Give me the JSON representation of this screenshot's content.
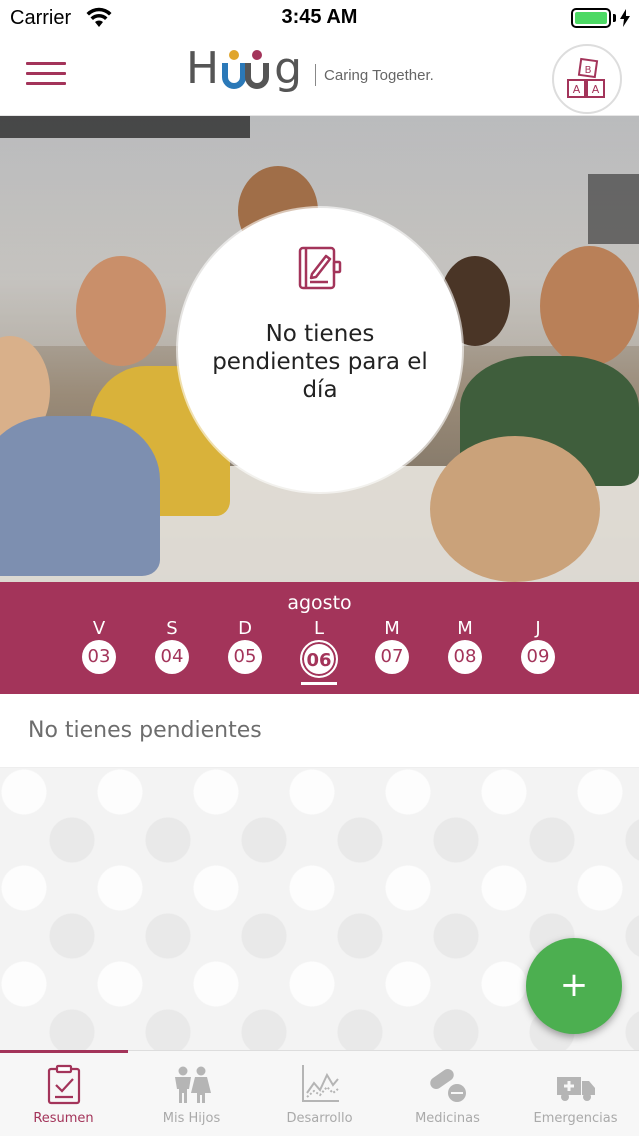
{
  "status_bar": {
    "carrier": "Carrier",
    "time": "3:45 AM"
  },
  "header": {
    "logo_text_h": "H",
    "logo_text_uu": "uu",
    "logo_text_g": "g",
    "tagline": "Caring Together.",
    "profile_icon": "abc-blocks-icon"
  },
  "hero": {
    "icon": "edit-notebook-icon",
    "message": "No tienes pendientes para el día"
  },
  "calendar": {
    "month": "agosto",
    "days": [
      {
        "letter": "V",
        "num": "03"
      },
      {
        "letter": "S",
        "num": "04"
      },
      {
        "letter": "D",
        "num": "05"
      },
      {
        "letter": "L",
        "num": "06",
        "selected": true
      },
      {
        "letter": "M",
        "num": "07"
      },
      {
        "letter": "M",
        "num": "08"
      },
      {
        "letter": "J",
        "num": "09"
      }
    ]
  },
  "pending": {
    "text": "No tienes pendientes"
  },
  "fab": {
    "label": "+"
  },
  "tabs": [
    {
      "label": "Resumen",
      "icon": "clipboard-check-icon",
      "active": true
    },
    {
      "label": "Mis Hijos",
      "icon": "children-icon"
    },
    {
      "label": "Desarrollo",
      "icon": "chart-line-icon"
    },
    {
      "label": "Medicinas",
      "icon": "pills-icon"
    },
    {
      "label": "Emergencias",
      "icon": "ambulance-icon"
    }
  ],
  "colors": {
    "brand": "#a3345a",
    "fab": "#4caf50",
    "battery": "#4cd964"
  }
}
